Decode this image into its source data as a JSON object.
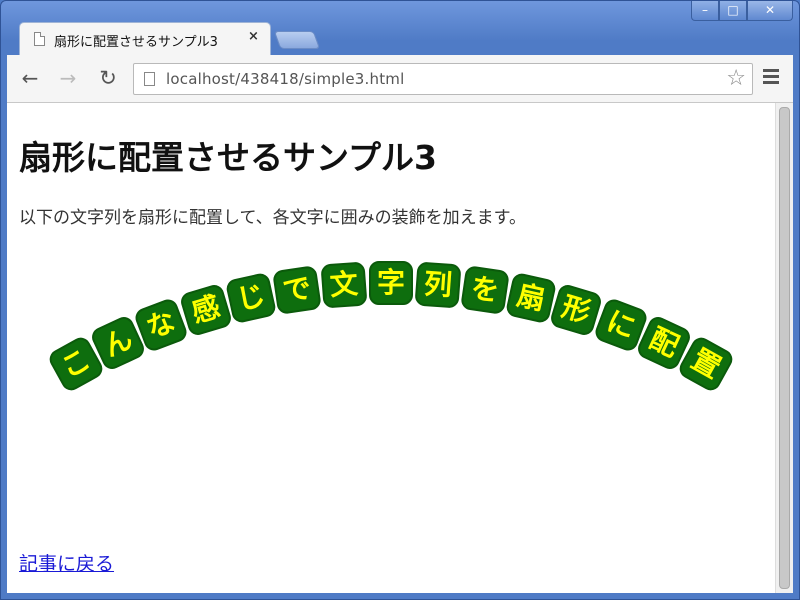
{
  "window": {
    "controls": {
      "minimize": "–",
      "maximize": "□",
      "close": "✕"
    }
  },
  "tab": {
    "title": "扇形に配置させるサンプル3",
    "close": "×",
    "icon": "page-icon"
  },
  "toolbar": {
    "back": "←",
    "forward": "→",
    "reload": "↻",
    "url": "localhost/438418/simple3.html",
    "star": "☆",
    "menu_icon": "menu-icon"
  },
  "content": {
    "heading": "扇形に配置させるサンプル3",
    "intro": "以下の文字列を扇形に配置して、各文字に囲みの装飾を加えます。",
    "fan_text": [
      "こ",
      "ん",
      "な",
      "感",
      "じ",
      "で",
      "文",
      "字",
      "列",
      "を",
      "扇",
      "形",
      "に",
      "配",
      "置"
    ],
    "back_link": "記事に戻る"
  },
  "colors": {
    "char_bg": "#0e6e0e",
    "char_text": "#ffff00",
    "link": "#1a1ad6",
    "frame": "#4f7bc6"
  }
}
